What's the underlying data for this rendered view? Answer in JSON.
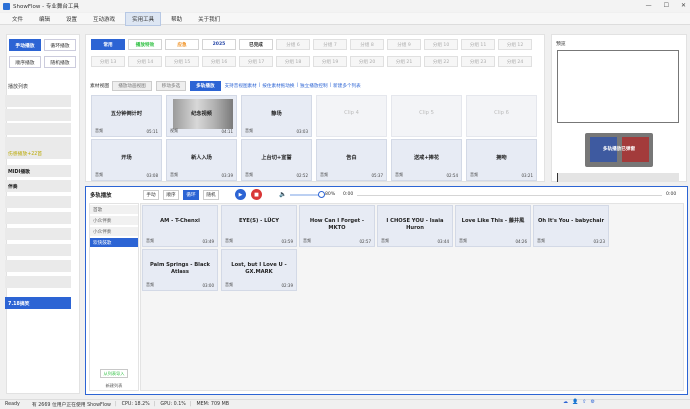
{
  "window": {
    "title": "ShowFlow - 专业舞台工具",
    "controls": [
      "—",
      "☐",
      "✕"
    ]
  },
  "menu": [
    {
      "label": "文件",
      "active": false
    },
    {
      "label": "编辑",
      "active": false
    },
    {
      "label": "设置",
      "active": false
    },
    {
      "label": "互动游戏",
      "active": false
    },
    {
      "label": "实用工具",
      "active": true
    },
    {
      "label": "帮助",
      "active": false
    },
    {
      "label": "关于我们",
      "active": false
    }
  ],
  "left": {
    "modes": [
      "手动播放",
      "循环播放",
      "顺序播放",
      "随机播放"
    ],
    "playlist_title": "播放列表",
    "items": [
      "",
      "",
      "",
      "",
      "",
      "",
      "伤感播放+22首",
      "MIDI播歌",
      "伴奏",
      "",
      "",
      "",
      "",
      "7.18搞笑"
    ]
  },
  "tabs": {
    "row1": [
      "常用",
      "播放特效",
      "应急",
      "2025",
      "已完成",
      "分组 6",
      "分组 7",
      "分组 8",
      "分组 9",
      "分组 10",
      "分组 11",
      "分组 12"
    ],
    "row2": [
      "分组 13",
      "分组 14",
      "分组 15",
      "分组 16",
      "分组 17",
      "分组 18",
      "分组 19",
      "分组 20",
      "分组 21",
      "分组 22",
      "分组 23",
      "分组 24"
    ]
  },
  "filter": {
    "label": "素材视图",
    "buttons": [
      "播放动画视图",
      "移动多选",
      "多轨播放"
    ],
    "links": [
      "支持音视图素材",
      "|",
      "按住素材拖动换",
      "|",
      "独立播放控制",
      "|",
      "新建多个列表"
    ]
  },
  "cards_row1": [
    {
      "title": "五分钟倒计时",
      "tag": "音频",
      "time": "05:11",
      "empty": false,
      "thumb": false
    },
    {
      "title": "纪念视频",
      "tag": "视频",
      "time": "04:11",
      "empty": false,
      "thumb": true
    },
    {
      "title": "静场",
      "tag": "音频",
      "time": "03:03",
      "empty": false,
      "thumb": false
    },
    {
      "title": "Clip 4",
      "tag": "",
      "time": "",
      "empty": true,
      "thumb": false
    },
    {
      "title": "Clip 5",
      "tag": "",
      "time": "",
      "empty": true,
      "thumb": false
    },
    {
      "title": "Clip 6",
      "tag": "",
      "time": "",
      "empty": true,
      "thumb": false
    }
  ],
  "cards_row2": [
    {
      "title": "开场",
      "tag": "音频",
      "mid": "",
      "time": "03:08"
    },
    {
      "title": "新人入场",
      "tag": "音频",
      "mid": "",
      "time": "03:39"
    },
    {
      "title": "上台切+宣誓",
      "tag": "音频",
      "mid": "",
      "time": "02:52"
    },
    {
      "title": "告白",
      "tag": "音频",
      "mid": "",
      "time": "05:37"
    },
    {
      "title": "送戒+捧花",
      "tag": "音频",
      "mid": "",
      "time": "02:54"
    },
    {
      "title": "拥吻",
      "tag": "音频",
      "mid": "",
      "time": "03:21"
    }
  ],
  "preview": {
    "label": "预览",
    "monitor_label": "多轨播放已弹窗"
  },
  "multitrack": {
    "title": "多轨播放",
    "buttons": [
      "手动",
      "顺序",
      "循环",
      "随机"
    ],
    "volume_percent": "80%",
    "time_start": "0:00",
    "time_end": "0:00",
    "lists": [
      "首歌",
      "小众伴奏",
      "小众伴奏",
      "欢快鼓歌"
    ],
    "add_button": "从列表导入",
    "new_list": "新建列表",
    "tracks": [
      {
        "title": "AM - T-Chenxi",
        "tag": "音频",
        "time": "03:49"
      },
      {
        "title": "EYE(S) - LÜCY",
        "tag": "音频",
        "time": "03:59"
      },
      {
        "title": "How Can I Forget - MKTO",
        "tag": "音频",
        "time": "02:57"
      },
      {
        "title": "I CHOSE YOU - Isaia Huron",
        "tag": "音频",
        "time": "03:44"
      },
      {
        "title": "Love Like This - 藤井風",
        "tag": "音频",
        "time": "04:26"
      },
      {
        "title": "Oh It's You - babychair",
        "tag": "音频",
        "time": "03:23"
      },
      {
        "title": "Palm Springs - Black Atlass",
        "tag": "音频",
        "time": "03:00"
      },
      {
        "title": "Lost, but I Love U - GX.MARK",
        "tag": "音频",
        "time": "02:39"
      }
    ]
  },
  "status": {
    "ready": "Ready",
    "users": "有 2669 位用户正在使用 ShowFlow",
    "cpu": "CPU: 18.2%",
    "gpu": "GPU: 0.1%",
    "mem": "MEM: 709 MB"
  },
  "tray_icons": [
    "cloud-icon",
    "person-icon",
    "upload-icon",
    "settings-icon"
  ]
}
